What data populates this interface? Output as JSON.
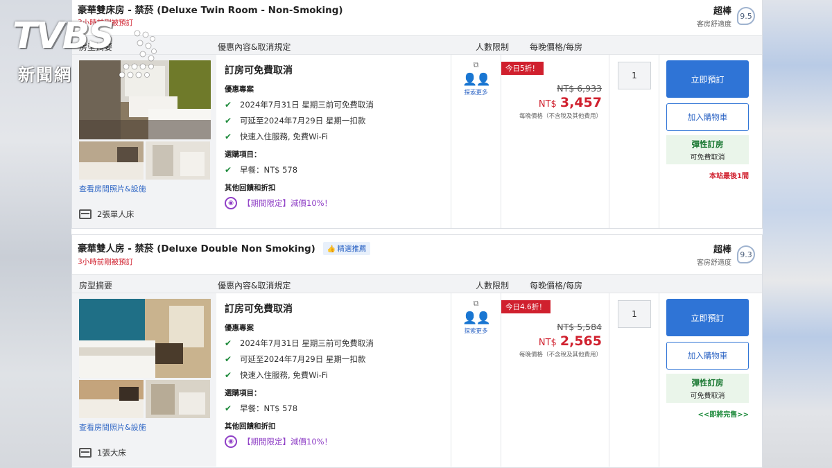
{
  "logo": {
    "main": "TVBS",
    "sub": "新聞網"
  },
  "columns": {
    "summary": "房型摘要",
    "deal": "優惠內容&取消規定",
    "people": "人數限制",
    "price": "每晚價格/每房"
  },
  "rooms": [
    {
      "title": "豪華雙床房 - 禁菸 (Deluxe Twin Room - Non-Smoking)",
      "recommend": "",
      "booked": "3小時前剛被預訂",
      "rating_word": "超棒",
      "rating_sub": "客房舒適度",
      "rating_score": "9.5",
      "photo_link": "查看房間照片&設施",
      "bed": "2張單人床",
      "deal_title": "訂房可免費取消",
      "deal_section1": "優惠專案",
      "deal_lines": [
        "2024年7月31日 星期三前可免費取消",
        "可延至2024年7月29日 星期一扣款",
        "快速入住服務, 免費Wi-Fi"
      ],
      "deal_section2": "選購項目：",
      "extra": "早餐：NT$ 578",
      "deal_section3": "其他回饋和折扣",
      "promo": "【期間限定】減價10%！",
      "people_link": "探索更多",
      "discount": "今日5折！",
      "orig_price": "NT$ 6,933",
      "currency": "NT$",
      "price": "3,457",
      "per_night": "每晚價格（不含稅及其他費用）",
      "qty": "1",
      "book": "立即預訂",
      "cart": "加入購物車",
      "flex_title": "彈性訂房",
      "flex_sub": "可免費取消",
      "note": "本站最後1間"
    },
    {
      "title": "豪華雙人房 - 禁菸 (Deluxe Double Non Smoking)",
      "recommend": "精選推薦",
      "booked": "3小時前剛被預訂",
      "rating_word": "超棒",
      "rating_sub": "客房舒適度",
      "rating_score": "9.3",
      "photo_link": "查看房間照片&設施",
      "bed": "1張大床",
      "deal_title": "訂房可免費取消",
      "deal_section1": "優惠專案",
      "deal_lines": [
        "2024年7月31日 星期三前可免費取消",
        "可延至2024年7月29日 星期一扣款",
        "快速入住服務, 免費Wi-Fi"
      ],
      "deal_section2": "選購項目：",
      "extra": "早餐：NT$ 578",
      "deal_section3": "其他回饋和折扣",
      "promo": "【期間限定】減價10%！",
      "people_link": "探索更多",
      "discount": "今日4.6折！",
      "orig_price": "NT$ 5,584",
      "currency": "NT$",
      "price": "2,565",
      "per_night": "每晚價格（不含稅及其他費用）",
      "qty": "1",
      "book": "立即預訂",
      "cart": "加入購物車",
      "flex_title": "彈性訂房",
      "flex_sub": "可免費取消",
      "note": "<<即將完售>>"
    }
  ]
}
